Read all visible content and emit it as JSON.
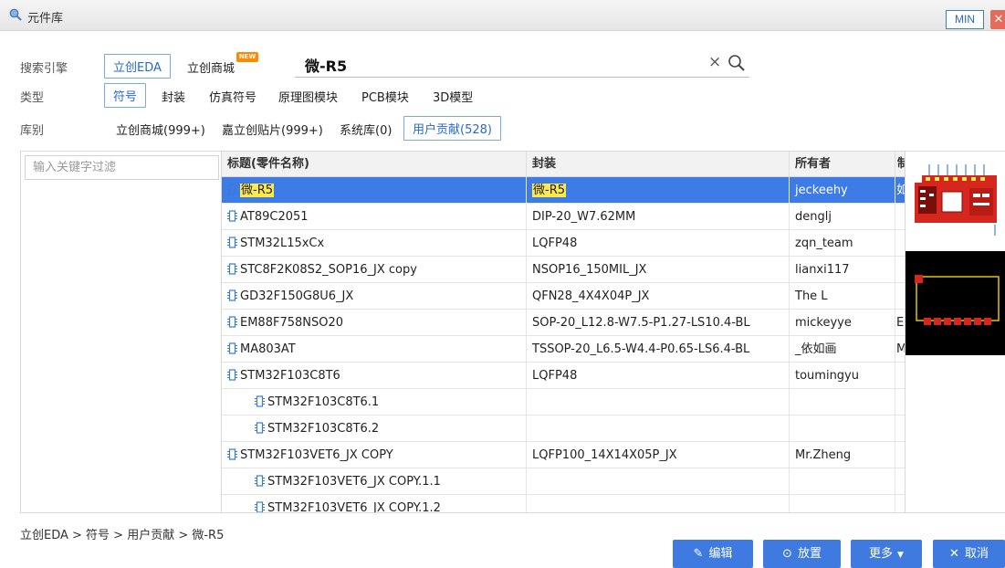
{
  "window": {
    "title": "元件库",
    "min_label": "MIN",
    "close_label": "✕"
  },
  "search": {
    "engine_label": "搜索引擎",
    "engines": [
      "立创EDA",
      "立创商城"
    ],
    "new_badge": "NEW",
    "value": "微-R5"
  },
  "type_row": {
    "label": "类型",
    "options": [
      "符号",
      "封装",
      "仿真符号",
      "原理图模块",
      "PCB模块",
      "3D模型"
    ]
  },
  "library_row": {
    "label": "库别",
    "options": [
      "立创商城(999+)",
      "嘉立创贴片(999+)",
      "系统库(0)",
      "用户贡献(528)"
    ]
  },
  "filter": {
    "placeholder": "输入关键字过滤"
  },
  "table": {
    "columns": [
      "标题(零件名称)",
      "封装",
      "所有者",
      "制"
    ],
    "rows": [
      {
        "title": "微-R5",
        "package": "微-R5",
        "owner": "jeckeehy",
        "extra": "如"
      },
      {
        "title": "AT89C2051",
        "package": "DIP-20_W7.62MM",
        "owner": "denglj",
        "extra": ""
      },
      {
        "title": "STM32L15xCx",
        "package": "LQFP48",
        "owner": "zqn_team",
        "extra": ""
      },
      {
        "title": "STC8F2K08S2_SOP16_JX copy",
        "package": "NSOP16_150MIL_JX",
        "owner": "lianxi117",
        "extra": ""
      },
      {
        "title": "GD32F150G8U6_JX",
        "package": "QFN28_4X4X04P_JX",
        "owner": "The L",
        "extra": ""
      },
      {
        "title": "EM88F758NSO20",
        "package": "SOP-20_L12.8-W7.5-P1.27-LS10.4-BL",
        "owner": "mickeyye",
        "extra": "E"
      },
      {
        "title": "MA803AT",
        "package": "TSSOP-20_L6.5-W4.4-P0.65-LS6.4-BL",
        "owner": "_依如画",
        "extra": "M"
      },
      {
        "title": "STM32F103C8T6",
        "package": "LQFP48",
        "owner": "toumingyu",
        "extra": ""
      },
      {
        "title": "STM32F103C8T6.1",
        "package": "",
        "owner": "",
        "extra": ""
      },
      {
        "title": "STM32F103C8T6.2",
        "package": "",
        "owner": "",
        "extra": ""
      },
      {
        "title": "STM32F103VET6_JX COPY",
        "package": "LQFP100_14X14X05P_JX",
        "owner": "Mr.Zheng",
        "extra": ""
      },
      {
        "title": "STM32F103VET6_JX COPY.1.1",
        "package": "",
        "owner": "",
        "extra": ""
      },
      {
        "title": "STM32F103VET6_JX COPY.1.2",
        "package": "",
        "owner": "",
        "extra": ""
      }
    ]
  },
  "breadcrumb": "立创EDA > 符号 > 用户贡献 > 微-R5",
  "buttons": {
    "edit": "编辑",
    "place": "放置",
    "more": "更多",
    "cancel": "取消"
  },
  "colors": {
    "accent": "#3f7ae0",
    "selected_row": "#3d7be6",
    "highlight": "#ffe94d",
    "pcb_red": "#d7261e"
  }
}
